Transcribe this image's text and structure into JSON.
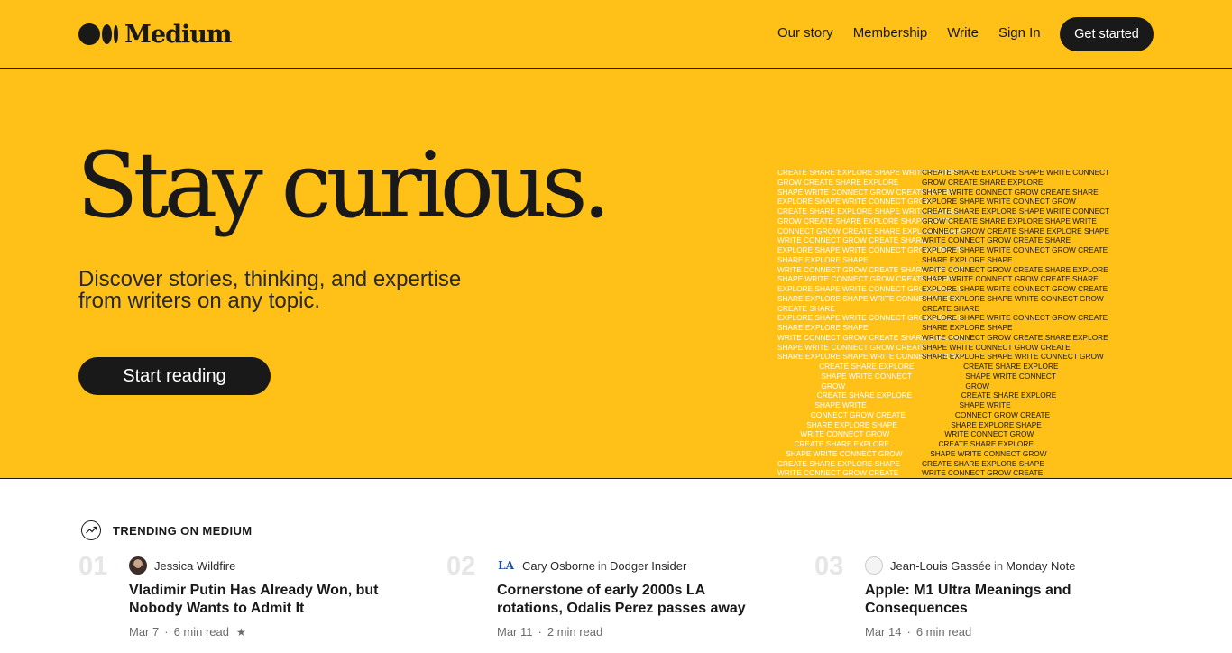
{
  "brand": {
    "name": "Medium"
  },
  "nav": {
    "links": [
      "Our story",
      "Membership",
      "Write",
      "Sign In"
    ],
    "cta": "Get started"
  },
  "hero": {
    "title": "Stay curious.",
    "subtitle": "Discover stories, thinking, and expertise from writers on any topic.",
    "button": "Start reading"
  },
  "art": {
    "left_lines": [
      "CREATE SHARE EXPLORE SHAPE WRITE CONNECT",
      "GROW CREATE SHARE EXPLORE",
      "SHAPE WRITE CONNECT GROW CREATE SHARE",
      "EXPLORE SHAPE WRITE CONNECT GROW",
      "CREATE SHARE EXPLORE SHAPE WRITE CONNECT",
      "GROW CREATE SHARE EXPLORE SHAPE WRITE",
      "CONNECT GROW CREATE SHARE EXPLORE SHAPE",
      "WRITE CONNECT GROW CREATE SHARE",
      "EXPLORE SHAPE WRITE CONNECT GROW CREATE",
      "SHARE EXPLORE SHAPE",
      "WRITE CONNECT GROW CREATE SHARE EXPLORE",
      "SHAPE WRITE CONNECT GROW CREATE SHARE",
      "EXPLORE SHAPE WRITE CONNECT GROW CREATE",
      "SHARE EXPLORE SHAPE WRITE CONNECT GROW",
      "CREATE SHARE",
      "EXPLORE SHAPE WRITE CONNECT GROW CREATE",
      "SHARE EXPLORE SHAPE",
      "WRITE CONNECT GROW CREATE SHARE EXPLORE",
      "SHAPE WRITE CONNECT GROW CREATE",
      "SHARE EXPLORE SHAPE WRITE CONNECT GROW",
      "                    CREATE SHARE EXPLORE",
      "                     SHAPE WRITE CONNECT",
      "                     GROW",
      "                   CREATE SHARE EXPLORE",
      "                  SHAPE WRITE",
      "                CONNECT GROW CREATE",
      "              SHARE EXPLORE SHAPE",
      "           WRITE CONNECT GROW",
      "        CREATE SHARE EXPLORE",
      "    SHAPE WRITE CONNECT GROW",
      "CREATE SHARE EXPLORE SHAPE",
      "WRITE CONNECT GROW CREATE"
    ],
    "right_lines": [
      "CREATE SHARE EXPLORE SHAPE WRITE CONNECT",
      "GROW CREATE SHARE EXPLORE",
      "SHAPE WRITE CONNECT GROW CREATE SHARE",
      "EXPLORE SHAPE WRITE CONNECT GROW",
      "CREATE SHARE EXPLORE SHAPE WRITE CONNECT",
      "GROW CREATE SHARE EXPLORE SHAPE WRITE",
      "CONNECT GROW CREATE SHARE EXPLORE SHAPE",
      "WRITE CONNECT GROW CREATE SHARE",
      "EXPLORE SHAPE WRITE CONNECT GROW CREATE",
      "SHARE EXPLORE SHAPE",
      "WRITE CONNECT GROW CREATE SHARE EXPLORE",
      "SHAPE WRITE CONNECT GROW CREATE SHARE",
      "EXPLORE SHAPE WRITE CONNECT GROW CREATE",
      "SHARE EXPLORE SHAPE WRITE CONNECT GROW",
      "CREATE SHARE",
      "EXPLORE SHAPE WRITE CONNECT GROW CREATE",
      "SHARE EXPLORE SHAPE",
      "WRITE CONNECT GROW CREATE SHARE EXPLORE",
      "SHAPE WRITE CONNECT GROW CREATE",
      "SHARE EXPLORE SHAPE WRITE CONNECT GROW",
      "                    CREATE SHARE EXPLORE",
      "                     SHAPE WRITE CONNECT",
      "                     GROW",
      "                   CREATE SHARE EXPLORE",
      "                  SHAPE WRITE",
      "                CONNECT GROW CREATE",
      "              SHARE EXPLORE SHAPE",
      "           WRITE CONNECT GROW",
      "        CREATE SHARE EXPLORE",
      "    SHAPE WRITE CONNECT GROW",
      "CREATE SHARE EXPLORE SHAPE",
      "WRITE CONNECT GROW CREATE"
    ]
  },
  "trending": {
    "label": "TRENDING ON MEDIUM",
    "posts": [
      {
        "number": "01",
        "author": "Jessica Wildfire",
        "publication": "",
        "title": "Vladimir Putin Has Already Won, but Nobody Wants to Admit It",
        "date": "Mar 7",
        "read_time": "6 min read",
        "starred": true
      },
      {
        "number": "02",
        "author": "Cary Osborne",
        "in_word": "in",
        "publication": "Dodger Insider",
        "avatar_glyph": "LA",
        "title": "Cornerstone of early 2000s LA rotations, Odalis Perez passes away",
        "date": "Mar 11",
        "read_time": "2 min read"
      },
      {
        "number": "03",
        "author": "Jean-Louis Gassée",
        "in_word": "in",
        "publication": "Monday Note",
        "title": "Apple: M1 Ultra Meanings and Consequences",
        "date": "Mar 14",
        "read_time": "6 min read"
      }
    ]
  },
  "colors": {
    "hero_bg": "#ffc017",
    "ink": "#191919",
    "muted": "#6b6b6b"
  }
}
